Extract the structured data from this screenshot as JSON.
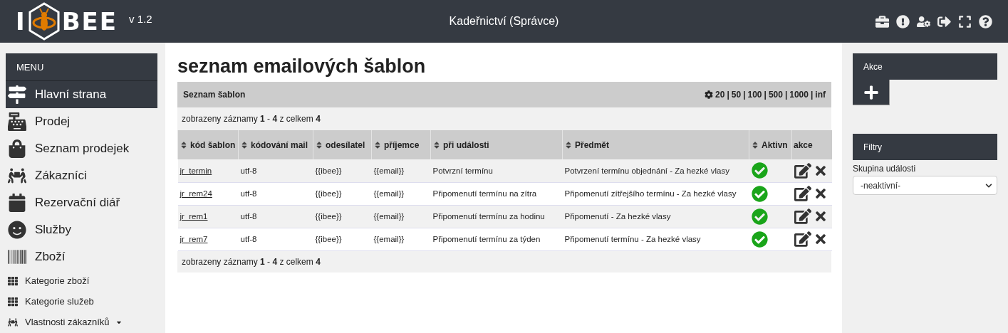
{
  "header": {
    "logo_left": "I",
    "logo_right": "BEE",
    "version": "v 1.2",
    "title": "Kadeřnictví (Správce)"
  },
  "sidebar": {
    "title": "MENU",
    "items": [
      {
        "label": "Hlavní strana",
        "kind": "large",
        "selected": true,
        "submenu": false
      },
      {
        "label": "Prodej",
        "kind": "large",
        "selected": false,
        "submenu": false
      },
      {
        "label": "Seznam prodejek",
        "kind": "large",
        "selected": false,
        "submenu": false
      },
      {
        "label": "Zákazníci",
        "kind": "large",
        "selected": false,
        "submenu": false
      },
      {
        "label": "Rezervační diář",
        "kind": "large",
        "selected": false,
        "submenu": false
      },
      {
        "label": "Služby",
        "kind": "large",
        "selected": false,
        "submenu": false
      },
      {
        "label": "Zboží",
        "kind": "large",
        "selected": false,
        "submenu": false
      },
      {
        "label": "Kategorie zboží",
        "kind": "small",
        "selected": false,
        "submenu": false
      },
      {
        "label": "Kategorie služeb",
        "kind": "small",
        "selected": false,
        "submenu": false
      },
      {
        "label": "Vlastnosti zákazníků",
        "kind": "small",
        "selected": false,
        "submenu": true
      }
    ]
  },
  "page_title": "seznam emailových šablon",
  "table": {
    "title": "Seznam šablon",
    "page_sizes": [
      "20",
      "50",
      "100",
      "500",
      "1000",
      "inf"
    ],
    "separator": "|",
    "info_top": "zobrazeny záznamy **1** - **4** z celkem **4**",
    "columns": [
      {
        "label": "kód šablon",
        "sortable": true
      },
      {
        "label": "kódování mail",
        "sortable": true
      },
      {
        "label": "odesílatel",
        "sortable": true
      },
      {
        "label": "příjemce",
        "sortable": true
      },
      {
        "label": "při události",
        "sortable": true
      },
      {
        "label": "Předmět",
        "sortable": true
      },
      {
        "label": "Aktivn",
        "sortable": true
      },
      {
        "label": "akce",
        "sortable": false
      }
    ],
    "rows": [
      {
        "code": "jr_termin",
        "encoding": "utf-8",
        "sender": "{{ibee}}",
        "recipient": "{{email}}",
        "event": "Potvrzní termínu",
        "subject": "Potvrzení termínu objednání - Za hezké vlasy",
        "active": true
      },
      {
        "code": "jr_rem24",
        "encoding": "utf-8",
        "sender": "{{ibee}}",
        "recipient": "{{email}}",
        "event": "Připomenutí termínu na zítra",
        "subject": "Připomenutí zítřejšího termínu - Za hezké vlasy",
        "active": true
      },
      {
        "code": "jr_rem1",
        "encoding": "utf-8",
        "sender": "{{ibee}}",
        "recipient": "{{email}}",
        "event": "Připomenutí termínu za hodinu",
        "subject": "Připomenutí - Za hezké vlasy",
        "active": true
      },
      {
        "code": "jr_rem7",
        "encoding": "utf-8",
        "sender": "{{ibee}}",
        "recipient": "{{email}}",
        "event": "Připomenutí termínu za týden",
        "subject": "Připomenutí termínu - Za hezké vlasy",
        "active": true
      }
    ],
    "info_bottom": "zobrazeny záznamy **1** - **4** z celkem **4**"
  },
  "actions": {
    "title": "Akce"
  },
  "filters": {
    "title": "Filtry",
    "label": "Skupina události",
    "value": "-neaktivní-"
  }
}
